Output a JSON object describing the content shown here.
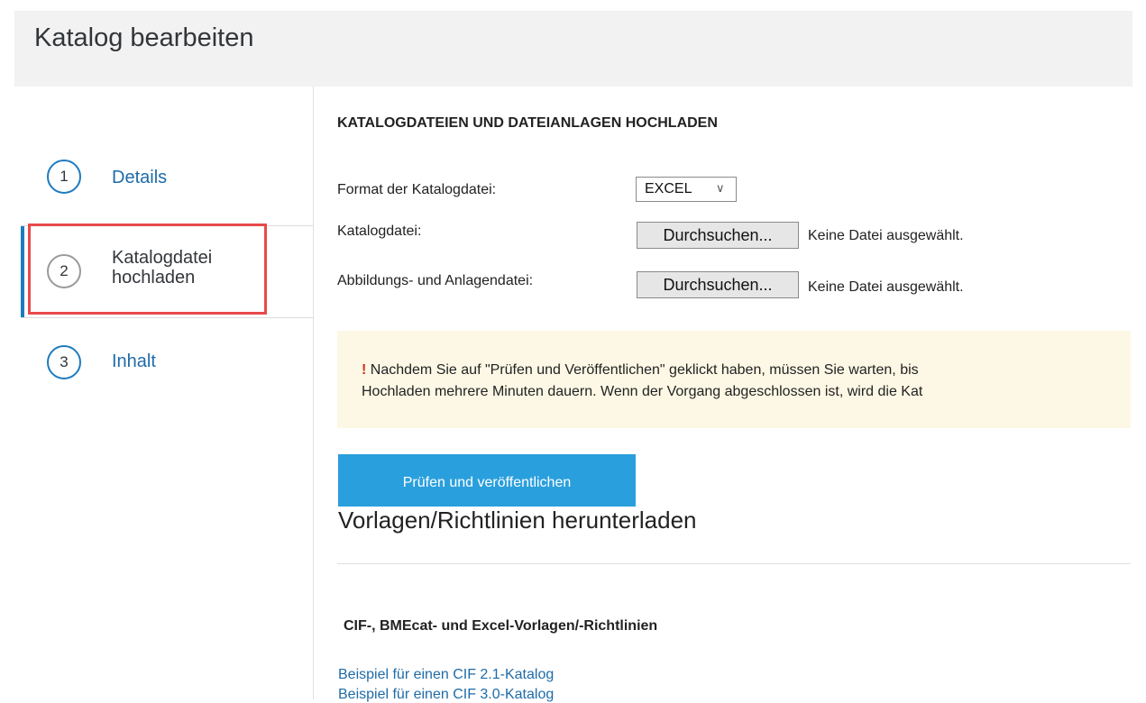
{
  "header": {
    "title": "Katalog bearbeiten"
  },
  "steps": [
    {
      "number": "1",
      "label": "Details"
    },
    {
      "number": "2",
      "label_line1": "Katalogdatei",
      "label_line2": "hochladen"
    },
    {
      "number": "3",
      "label": "Inhalt"
    }
  ],
  "upload": {
    "heading": "KATALOGDATEIEN UND DATEIANLAGEN HOCHLADEN",
    "format_label": "Format der Katalogdatei:",
    "format_value": "EXCEL",
    "catalog_file_label": "Katalogdatei:",
    "attachments_label": "Abbildungs- und Anlagendatei:",
    "browse_label": "Durchsuchen...",
    "no_file_text": "Keine Datei ausgewählt."
  },
  "notice": {
    "exclamation": "!",
    "line1": "Nachdem Sie auf \"Prüfen und Veröffentlichen\" geklickt haben, müssen Sie warten, bis",
    "line2": "Hochladen mehrere Minuten dauern. Wenn der Vorgang abgeschlossen ist, wird die Kat"
  },
  "actions": {
    "publish_label": "Prüfen und veröffentlichen"
  },
  "templates": {
    "title": "Vorlagen/Richtlinien herunterladen",
    "subheading": "CIF-, BMEcat- und Excel-Vorlagen/-Richtlinien",
    "links": [
      "Beispiel für einen CIF 2.1-Katalog",
      "Beispiel für einen CIF 3.0-Katalog"
    ]
  },
  "colors": {
    "accent": "#1e7bc0",
    "primary_button": "#2a9fdd",
    "highlight_border": "#e8494b",
    "notice_bg": "#fdf8e5",
    "link": "#1e6ba8"
  }
}
